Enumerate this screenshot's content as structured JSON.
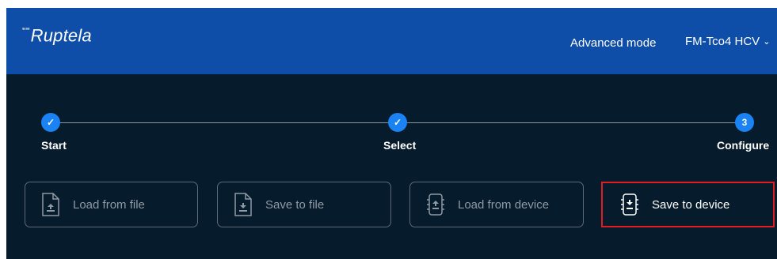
{
  "header": {
    "logo_mark": "\"\"",
    "logo_text": "Ruptela",
    "advanced_mode": "Advanced mode",
    "device": "FM-Tco4 HCV",
    "device_chevron": "⌄"
  },
  "stepper": {
    "steps": [
      {
        "label": "Start",
        "marker": "✓",
        "state": "done"
      },
      {
        "label": "Select",
        "marker": "✓",
        "state": "done"
      },
      {
        "label": "Configure",
        "marker": "3",
        "state": "current"
      }
    ]
  },
  "actions": [
    {
      "label": "Load from file",
      "icon": "file-upload-icon",
      "state": "disabled"
    },
    {
      "label": "Save to file",
      "icon": "file-download-icon",
      "state": "disabled"
    },
    {
      "label": "Load from device",
      "icon": "device-upload-icon",
      "state": "disabled"
    },
    {
      "label": "Save to device",
      "icon": "device-download-icon",
      "state": "highlighted"
    }
  ],
  "colors": {
    "header_bg": "#0f4ea8",
    "main_bg": "#061b2c",
    "step_accent": "#1a82f3",
    "highlight_border": "#e11d23"
  }
}
